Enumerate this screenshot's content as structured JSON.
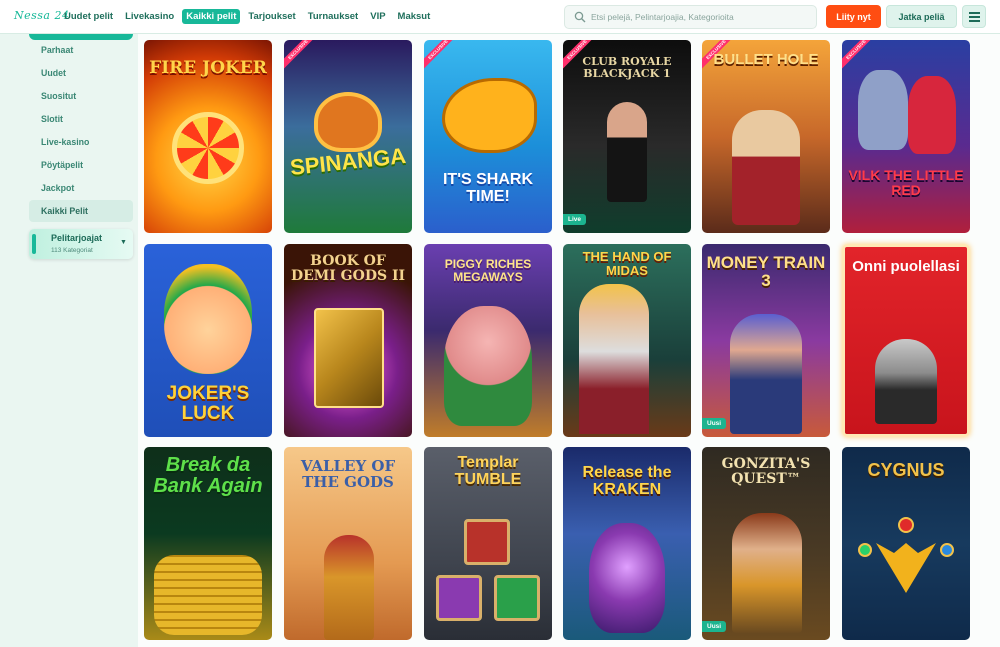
{
  "brand": {
    "logo_text": "Nessa 24"
  },
  "nav": [
    {
      "label": "Uudet pelit",
      "active": false
    },
    {
      "label": "Livekasino",
      "active": false
    },
    {
      "label": "Kaikki pelit",
      "active": true
    },
    {
      "label": "Tarjoukset",
      "active": false
    },
    {
      "label": "Turnaukset",
      "active": false
    },
    {
      "label": "VIP",
      "active": false
    },
    {
      "label": "Maksut",
      "active": false
    }
  ],
  "search": {
    "placeholder": "Etsi pelejä, Pelintarjoajia, Kategorioita"
  },
  "actions": {
    "join_label": "Liity nyt",
    "continue_label": "Jatka peliä"
  },
  "sidebar": {
    "items": [
      {
        "label": "Parhaat"
      },
      {
        "label": "Uudet"
      },
      {
        "label": "Suositut"
      },
      {
        "label": "Slotit"
      },
      {
        "label": "Live-kasino"
      },
      {
        "label": "Pöytäpelit"
      },
      {
        "label": "Jackpot"
      },
      {
        "label": "Kaikki Pelit",
        "active": true
      }
    ],
    "providers": {
      "label": "Pelitarjoajat",
      "sublabel": "113 Kategoriat"
    }
  },
  "games": [
    {
      "title": "FIRE JOKER"
    },
    {
      "title": "SPINANGA",
      "badge": "EXCLUSIVE"
    },
    {
      "title": "IT'S SHARK TIME!",
      "badge": "EXCLUSIVE"
    },
    {
      "title": "CLUB ROYALE BLACKJACK 1",
      "badge": "EXCLUSIVE",
      "tag": "Live"
    },
    {
      "title": "BULLET HOLE",
      "badge": "EXCLUSIVE"
    },
    {
      "title": "VILK THE LITTLE RED",
      "badge": "EXCLUSIVE"
    },
    {
      "title": "JOKER'S LUCK"
    },
    {
      "title": "BOOK OF DEMI GODS II"
    },
    {
      "title": "PIGGY RICHES MEGAWAYS"
    },
    {
      "title": "THE HAND OF MIDAS"
    },
    {
      "title": "MONEY TRAIN 3",
      "tag": "Uusi"
    },
    {
      "title": "Onni puolellasi"
    },
    {
      "title": "Break da Bank Again"
    },
    {
      "title": "VALLEY OF THE GODS"
    },
    {
      "title": "Templar TUMBLE"
    },
    {
      "title": "Release the KRAKEN"
    },
    {
      "title": "GONZITA'S QUEST™",
      "tag": "Uusi"
    },
    {
      "title": "CYGNUS"
    }
  ],
  "colors": {
    "accent": "#18b899",
    "cta": "#ff4d12",
    "exclusive": "#ff2f6b"
  }
}
